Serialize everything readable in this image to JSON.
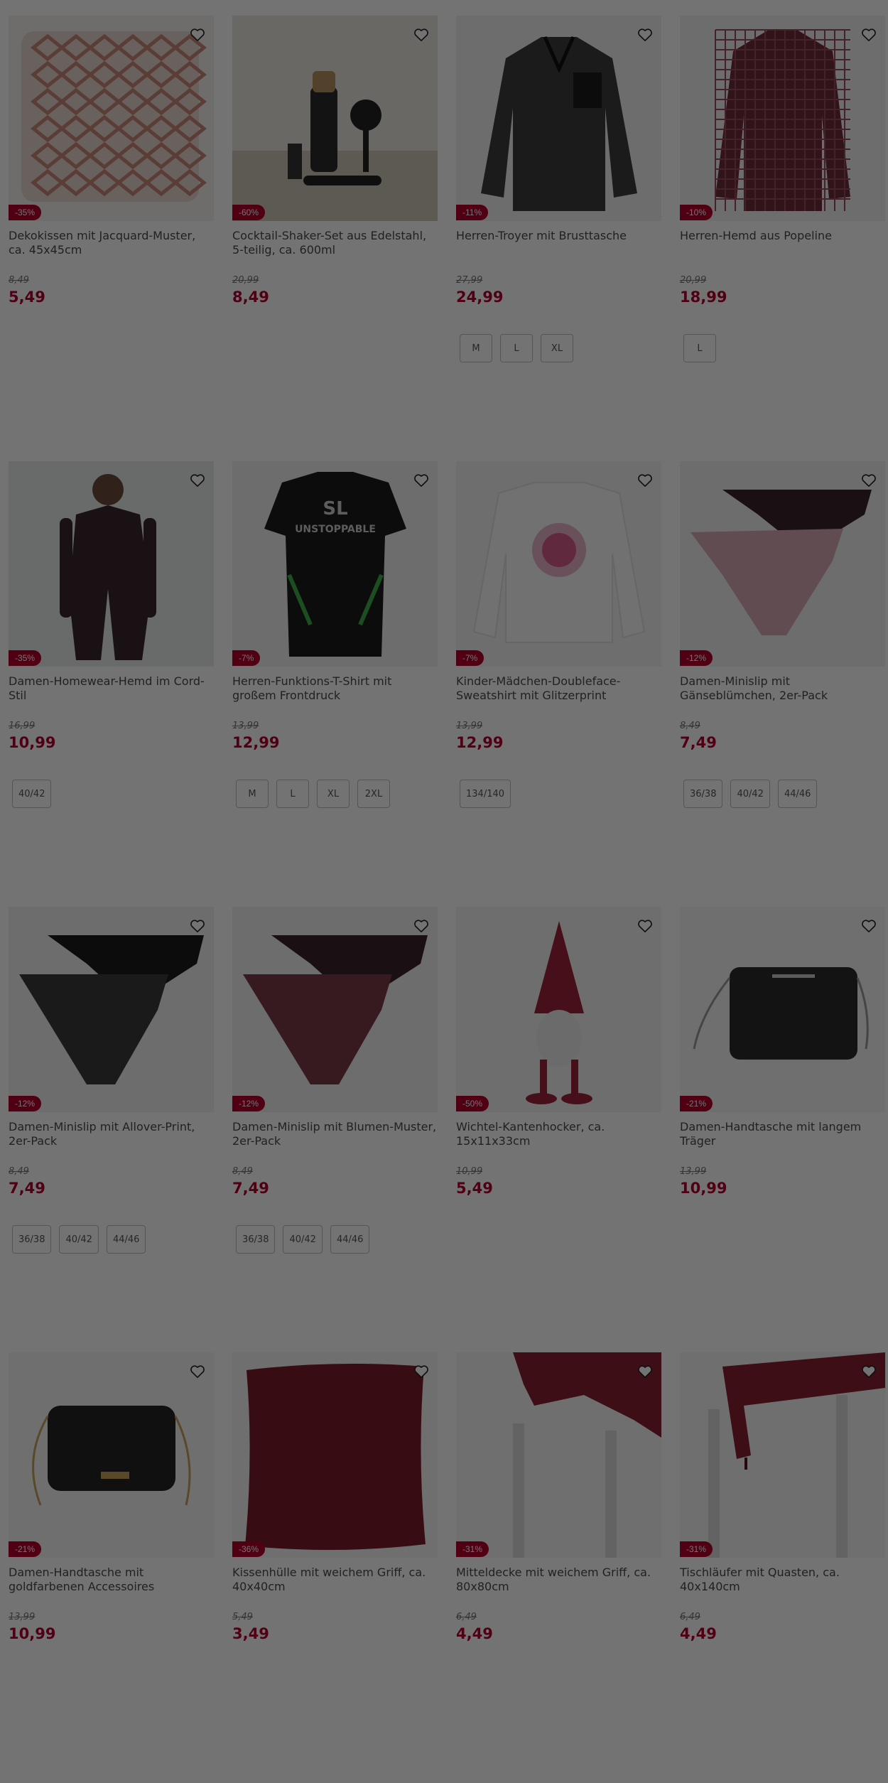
{
  "colors": {
    "accent": "#b3002d",
    "overlay": "rgba(0,0,0,0.55)"
  },
  "products": [
    {
      "title": "Dekokissen mit Jacquard-Muster, ca. 45x45cm",
      "discount": "-35%",
      "old_price": "8,49",
      "price": "5,49",
      "sizes": [],
      "image": "cushion-jacquard"
    },
    {
      "title": "Cocktail-Shaker-Set aus Edelstahl, 5-teilig, ca. 600ml",
      "discount": "-60%",
      "old_price": "20,99",
      "price": "8,49",
      "sizes": [],
      "image": "cocktail-set"
    },
    {
      "title": "Herren-Troyer mit Brusttasche",
      "discount": "-11%",
      "old_price": "27,99",
      "price": "24,99",
      "sizes": [
        "M",
        "L",
        "XL"
      ],
      "image": "troyer"
    },
    {
      "title": "Herren-Hemd aus Popeline",
      "discount": "-10%",
      "old_price": "20,99",
      "price": "18,99",
      "sizes": [
        "L"
      ],
      "image": "shirt-check"
    },
    {
      "title": "Damen-Homewear-Hemd im Cord-Stil",
      "discount": "-35%",
      "old_price": "16,99",
      "price": "10,99",
      "sizes": [
        "40/42"
      ],
      "image": "homewear"
    },
    {
      "title": "Herren-Funktions-T-Shirt mit großem Frontdruck",
      "discount": "-7%",
      "old_price": "13,99",
      "price": "12,99",
      "sizes": [
        "M",
        "L",
        "XL",
        "2XL"
      ],
      "image": "tshirt"
    },
    {
      "title": "Kinder-Mädchen-Doubleface-Sweatshirt mit Glitzerprint",
      "discount": "-7%",
      "old_price": "13,99",
      "price": "12,99",
      "sizes": [
        "134/140"
      ],
      "image": "sweatshirt"
    },
    {
      "title": "Damen-Minislip mit Gänseblümchen, 2er-Pack",
      "discount": "-12%",
      "old_price": "8,49",
      "price": "7,49",
      "sizes": [
        "36/38",
        "40/42",
        "44/46"
      ],
      "image": "slip-pink"
    },
    {
      "title": "Damen-Minislip mit Allover-Print, 2er-Pack",
      "discount": "-12%",
      "old_price": "8,49",
      "price": "7,49",
      "sizes": [
        "36/38",
        "40/42",
        "44/46"
      ],
      "image": "slip-black"
    },
    {
      "title": "Damen-Minislip mit Blumen-Muster, 2er-Pack",
      "discount": "-12%",
      "old_price": "8,49",
      "price": "7,49",
      "sizes": [
        "36/38",
        "40/42",
        "44/46"
      ],
      "image": "slip-wine"
    },
    {
      "title": "Wichtel-Kantenhocker, ca. 15x11x33cm",
      "discount": "-50%",
      "old_price": "10,99",
      "price": "5,49",
      "sizes": [],
      "image": "gnome"
    },
    {
      "title": "Damen-Handtasche mit langem Träger",
      "discount": "-21%",
      "old_price": "13,99",
      "price": "10,99",
      "sizes": [],
      "image": "bag-quilt"
    },
    {
      "title": "Damen-Handtasche mit goldfarbenen Accessoires",
      "discount": "-21%",
      "old_price": "13,99",
      "price": "10,99",
      "sizes": [],
      "image": "bag-gold"
    },
    {
      "title": "Kissenhülle mit weichem Griff, ca. 40x40cm",
      "discount": "-36%",
      "old_price": "5,49",
      "price": "3,49",
      "sizes": [],
      "image": "cushion-red"
    },
    {
      "title": "Mitteldecke mit weichem Griff, ca. 80x80cm",
      "discount": "-31%",
      "old_price": "6,49",
      "price": "4,49",
      "sizes": [],
      "image": "table-cover"
    },
    {
      "title": "Tischläufer mit Quasten, ca. 40x140cm",
      "discount": "-31%",
      "old_price": "6,49",
      "price": "4,49",
      "sizes": [],
      "image": "table-runner"
    }
  ]
}
